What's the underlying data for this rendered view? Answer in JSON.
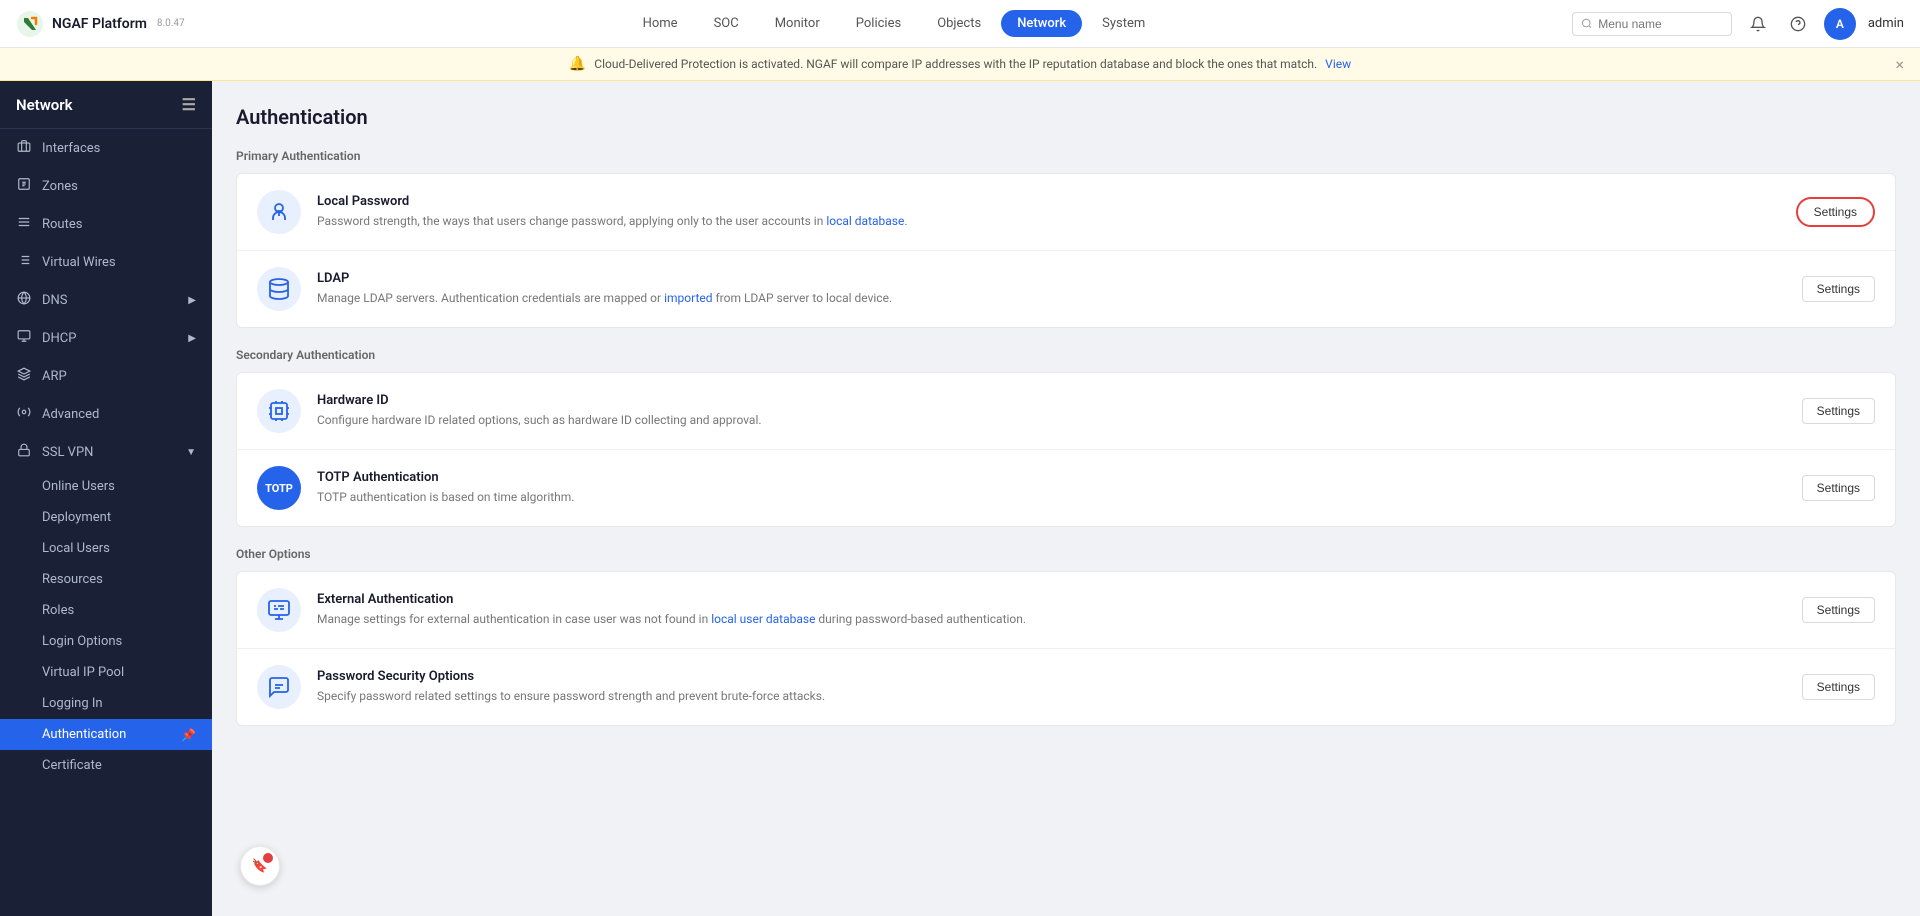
{
  "brand": {
    "logo_text": "N",
    "name": "NGAF Platform",
    "version": "8.0.47"
  },
  "nav": {
    "items": [
      {
        "label": "Home",
        "active": false
      },
      {
        "label": "SOC",
        "active": false
      },
      {
        "label": "Monitor",
        "active": false
      },
      {
        "label": "Policies",
        "active": false
      },
      {
        "label": "Objects",
        "active": false
      },
      {
        "label": "Network",
        "active": true
      },
      {
        "label": "System",
        "active": false
      }
    ]
  },
  "search": {
    "placeholder": "Menu name"
  },
  "user": {
    "name": "admin"
  },
  "banner": {
    "message": "Cloud-Delivered Protection is activated. NGAF will compare IP addresses with the IP reputation database and block the ones that match.",
    "link_text": "View"
  },
  "sidebar": {
    "title": "Network",
    "items": [
      {
        "label": "Interfaces",
        "icon": "interface"
      },
      {
        "label": "Zones",
        "icon": "zone"
      },
      {
        "label": "Routes",
        "icon": "route"
      },
      {
        "label": "Virtual Wires",
        "icon": "wire"
      },
      {
        "label": "DNS",
        "icon": "dns",
        "has_arrow": true
      },
      {
        "label": "DHCP",
        "icon": "dhcp",
        "has_arrow": true
      },
      {
        "label": "ARP",
        "icon": "arp"
      },
      {
        "label": "Advanced",
        "icon": "advanced"
      },
      {
        "label": "SSL VPN",
        "icon": "vpn",
        "has_arrow": true,
        "expanded": true
      }
    ],
    "ssl_vpn_children": [
      {
        "label": "Online Users"
      },
      {
        "label": "Deployment"
      },
      {
        "label": "Local Users"
      },
      {
        "label": "Resources"
      },
      {
        "label": "Roles"
      },
      {
        "label": "Login Options"
      },
      {
        "label": "Virtual IP Pool"
      },
      {
        "label": "Logging In"
      },
      {
        "label": "Authentication",
        "active": true
      },
      {
        "label": "Certificate"
      }
    ]
  },
  "page": {
    "title": "Authentication"
  },
  "primary_auth": {
    "label": "Primary Authentication",
    "items": [
      {
        "title": "Local Password",
        "description": "Password strength, the ways that users change password, applying only to the user accounts in local database.",
        "button_label": "Settings",
        "highlighted": true
      },
      {
        "title": "LDAP",
        "description": "Manage LDAP servers. Authentication credentials are mapped or imported from LDAP server to local device.",
        "button_label": "Settings",
        "highlighted": false
      }
    ]
  },
  "secondary_auth": {
    "label": "Secondary Authentication",
    "items": [
      {
        "title": "Hardware ID",
        "description": "Configure hardware ID related options, such as hardware ID collecting and approval.",
        "button_label": "Settings"
      },
      {
        "title": "TOTP Authentication",
        "description": "TOTP authentication is based on time algorithm.",
        "button_label": "Settings",
        "is_totp": true
      }
    ]
  },
  "other_options": {
    "label": "Other Options",
    "items": [
      {
        "title": "External Authentication",
        "description": "Manage settings for external authentication in case user was not found in local user database during password-based authentication.",
        "button_label": "Settings"
      },
      {
        "title": "Password Security Options",
        "description": "Specify password related settings to ensure password strength and prevent brute-force attacks.",
        "button_label": "Settings"
      }
    ]
  }
}
